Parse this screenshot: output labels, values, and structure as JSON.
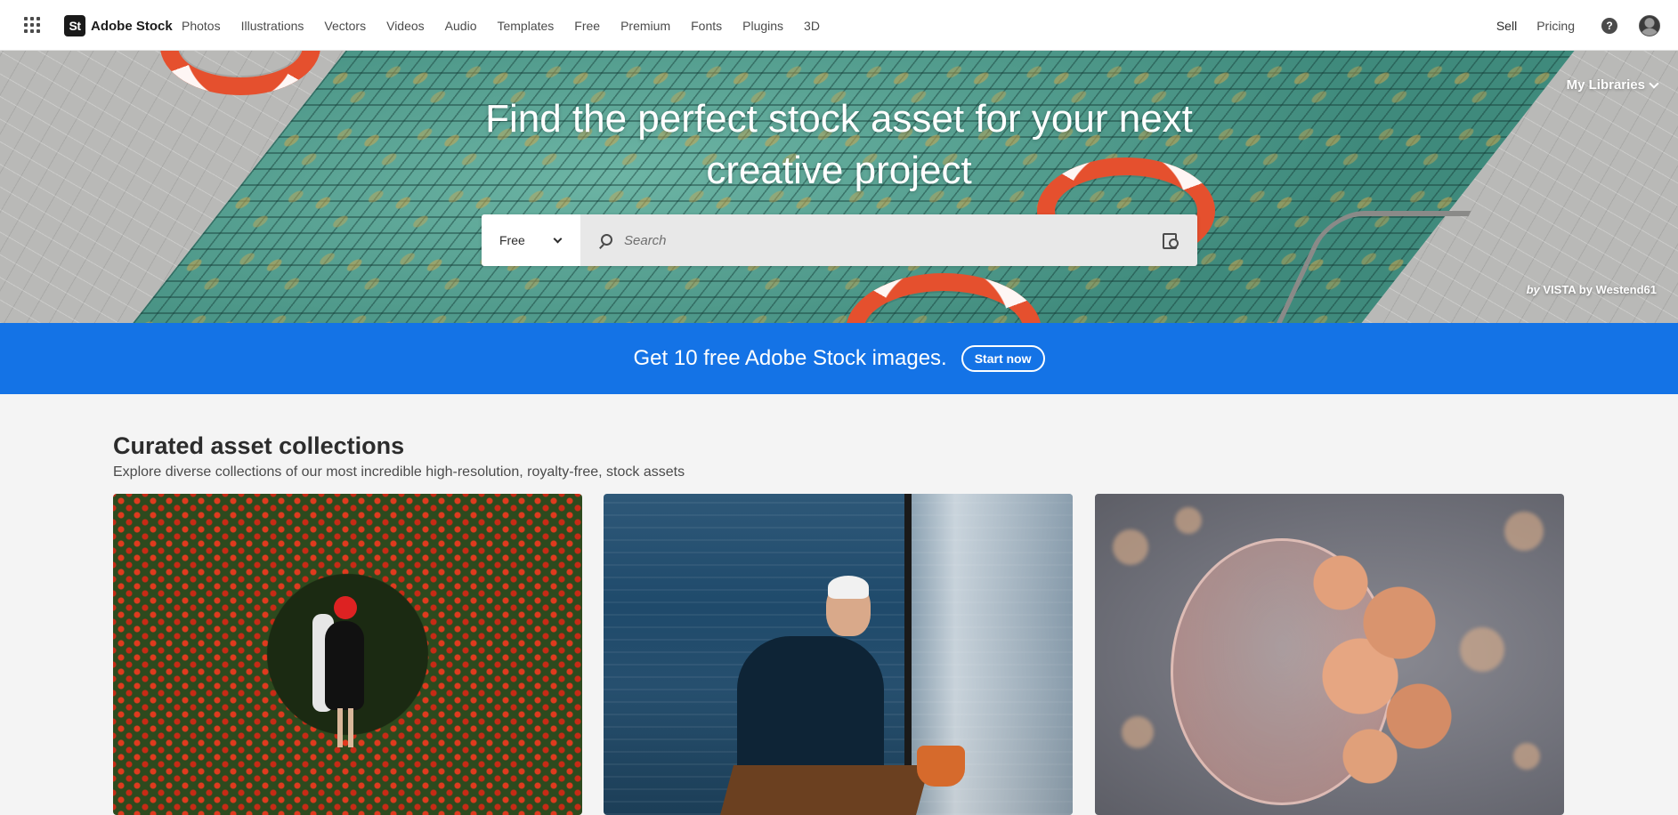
{
  "nav": {
    "brand": "Adobe Stock",
    "brand_mark": "St",
    "links": [
      "Photos",
      "Illustrations",
      "Vectors",
      "Videos",
      "Audio",
      "Templates",
      "Free",
      "Premium",
      "Fonts",
      "Plugins",
      "3D"
    ],
    "sell": "Sell",
    "pricing": "Pricing",
    "help": "?"
  },
  "hero": {
    "title_line1": "Find the perfect stock asset for your next",
    "title_line2": "creative project",
    "my_libraries": "My Libraries",
    "credit_by": "by",
    "credit_name": "VISTA by Westend61"
  },
  "search": {
    "type_value": "Free",
    "placeholder": "Search"
  },
  "promo": {
    "text": "Get 10 free Adobe Stock images.",
    "button": "Start now",
    "color": "#1473e6"
  },
  "collections": {
    "title": "Curated asset collections",
    "subtitle": "Explore diverse collections of our most incredible high-resolution, royalty-free, stock assets"
  },
  "icons": [
    "apps-grid-icon",
    "help-icon",
    "avatar",
    "chevron-down-icon",
    "search-icon",
    "visual-search-icon"
  ]
}
